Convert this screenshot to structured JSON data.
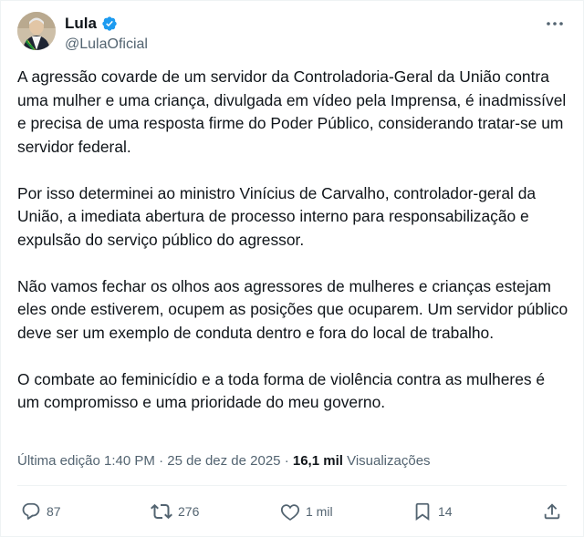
{
  "author": {
    "name": "Lula",
    "handle": "@LulaOficial",
    "verified_icon": "verified-badge-icon",
    "avatar_icon": "profile-avatar"
  },
  "tweet": {
    "paragraphs": [
      "A agressão covarde de um servidor da Controladoria-Geral da União contra uma mulher e uma criança, divulgada em vídeo pela Imprensa, é inadmissível e precisa de uma resposta firme do Poder Público, considerando tratar-se um servidor federal.",
      "Por isso determinei ao ministro Vinícius de Carvalho, controlador-geral da União, a imediata abertura de processo interno para responsabilização e expulsão do serviço público do agressor.",
      "Não vamos fechar os olhos aos agressores de mulheres e crianças estejam eles onde estiverem, ocupem as posições que ocuparem. Um servidor público deve ser um exemplo de conduta dentro e fora do local de trabalho.",
      "O combate ao feminicídio e a toda forma de violência contra as mulheres é um compromisso e uma prioridade do meu governo."
    ]
  },
  "meta": {
    "edited_label": "Última edição 1:40 PM",
    "separator1": " · ",
    "date": "25 de dez de 2025",
    "separator2": " · ",
    "views_count": "16,1 mil",
    "views_label": " Visualizações"
  },
  "actions": {
    "replies": "87",
    "reposts": "276",
    "likes": "1 mil",
    "bookmarks": "14"
  },
  "colors": {
    "text": "#0f1419",
    "secondary": "#536471",
    "verified": "#1d9bf0",
    "divider": "#eff3f4"
  }
}
